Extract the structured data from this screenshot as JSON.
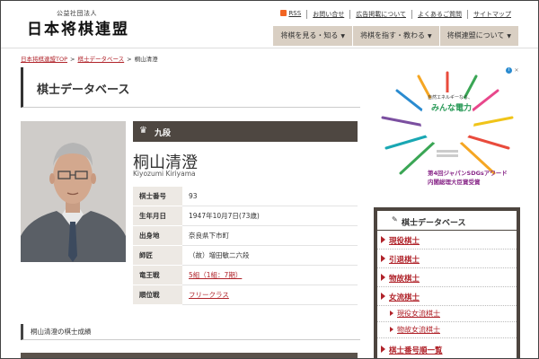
{
  "header": {
    "org_type": "公益社団法人",
    "org_name": "日本将棋連盟",
    "rss": "RSS",
    "top_links": [
      "お問い合せ",
      "広告掲載について",
      "よくあるご質問",
      "サイトマップ"
    ],
    "nav": [
      "将棋を見る・知る",
      "将棋を指す・教わる",
      "将棋連盟について"
    ],
    "nav_arrow": "▼"
  },
  "breadcrumb": [
    "日本将棋連盟TOP",
    "棋士データベース",
    "桐山清澄"
  ],
  "breadcrumb_sep": ">",
  "page_title": "棋士データベース",
  "player": {
    "rank": "九段",
    "name": "桐山清澄",
    "name_en": "Kiyozumi Kiriyama",
    "info": [
      {
        "key": "棋士番号",
        "value": "93"
      },
      {
        "key": "生年月日",
        "value": "1947年10月7日(73歳)"
      },
      {
        "key": "出身地",
        "value": "奈良県下市町"
      },
      {
        "key": "師匠",
        "value": "（故）増田敏二六段"
      },
      {
        "key": "竜王戦",
        "value": "5組（1組：7期）"
      },
      {
        "key": "順位戦",
        "value": "フリークラス"
      }
    ]
  },
  "records_heading": "桐山清澄の棋士成績",
  "ad": {
    "line1": "自然エネルギーなら、",
    "line2": "みんな電力",
    "line3": "第4回ジャパンSDGsアワード",
    "line4": "内閣総理大臣賞受賞"
  },
  "sidebar": {
    "title": "棋士データベース",
    "items": [
      "現役棋士",
      "引退棋士",
      "物故棋士",
      "女流棋士"
    ],
    "sub_items": [
      "現役女流棋士",
      "物故女流棋士"
    ],
    "last_item": "棋士番号順一覧"
  },
  "colors": {
    "accent": "#b0232a",
    "dark": "#4e4741",
    "nav_bg": "#d9cfc3"
  }
}
